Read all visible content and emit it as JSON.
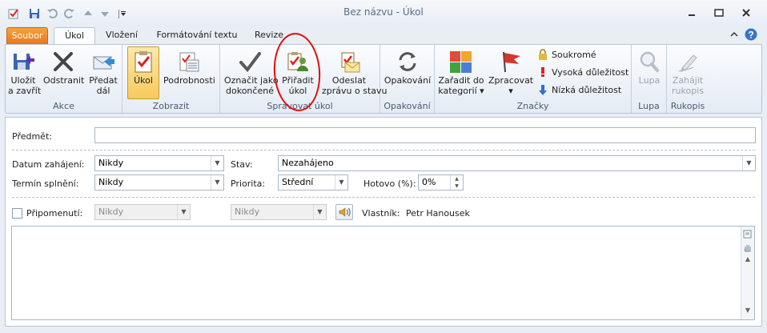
{
  "window": {
    "title": "Bez názvu - Úkol",
    "qat_icons": [
      "app-task-icon",
      "save-icon",
      "undo-icon",
      "redo-icon",
      "up-icon",
      "down-icon",
      "customize-icon"
    ],
    "controls": [
      "minimize",
      "restore",
      "close"
    ]
  },
  "tabs": [
    {
      "label": "Soubor",
      "kind": "file"
    },
    {
      "label": "Úkol",
      "kind": "active"
    },
    {
      "label": "Vložení",
      "kind": ""
    },
    {
      "label": "Formátování textu",
      "kind": ""
    },
    {
      "label": "Revize",
      "kind": ""
    }
  ],
  "ribbon": {
    "akce": {
      "label": "Akce",
      "save_l1": "Uložit",
      "save_l2": "a zavřít",
      "delete": "Odstranit",
      "forward_l1": "Předat",
      "forward_l2": "dál"
    },
    "zobrazit": {
      "label": "Zobrazit",
      "task": "Úkol",
      "details": "Podrobnosti"
    },
    "spravovat": {
      "label": "Spravovat úkol",
      "mark_l1": "Označit jako",
      "mark_l2": "dokončené",
      "assign_l1": "Přiřadit",
      "assign_l2": "úkol",
      "send_l1": "Odeslat",
      "send_l2": "zprávu o stavu"
    },
    "opakovani": {
      "label": "Opakování",
      "button": "Opakování"
    },
    "znacky": {
      "label": "Značky",
      "cat_l1": "Zařadit do",
      "cat_l2": "kategorií",
      "followup_l1": "Zpracovat",
      "private": "Soukromé",
      "high": "Vysoká důležitost",
      "low": "Nízká důležitost"
    },
    "lupa": {
      "label": "Lupa",
      "button": "Lupa"
    },
    "rukopis": {
      "label": "Rukopis",
      "l1": "Zahájit",
      "l2": "rukopis"
    }
  },
  "form": {
    "subject_label": "Předmět:",
    "subject_value": "",
    "start_label": "Datum zahájení:",
    "start_value": "Nikdy",
    "due_label": "Termín splnění:",
    "due_value": "Nikdy",
    "status_label": "Stav:",
    "status_value": "Nezahájeno",
    "priority_label": "Priorita:",
    "priority_value": "Střední",
    "done_label": "Hotovo (%):",
    "done_value": "0%",
    "reminder_label": "Připomenutí:",
    "reminder_checked": false,
    "reminder_date": "Nikdy",
    "reminder_time": "Nikdy",
    "owner_label": "Vlastník:",
    "owner_value": "Petr Hanousek"
  },
  "colors": {
    "file_tab": "#e5771c",
    "annotation_circle": "#e10c0c",
    "ribbon_bg": "#e4ebf4"
  }
}
